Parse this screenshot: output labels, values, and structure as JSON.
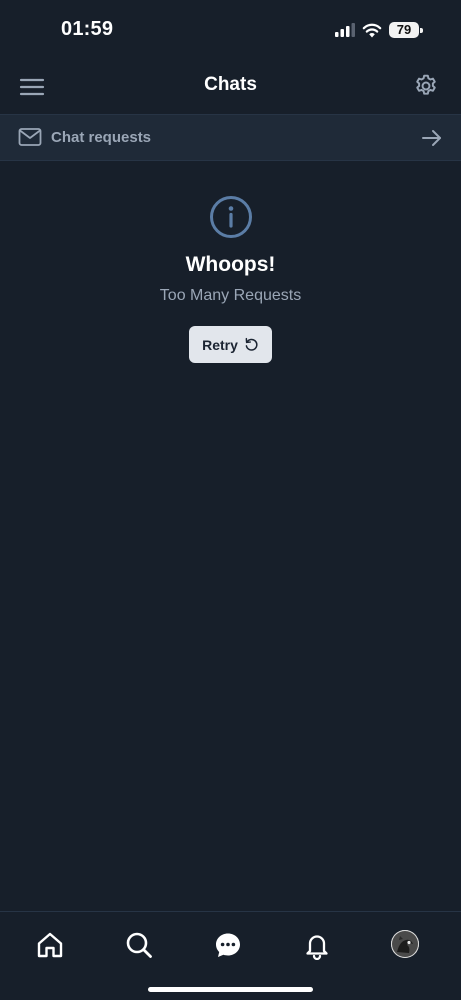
{
  "status_bar": {
    "time": "01:59",
    "battery": "79"
  },
  "header": {
    "title": "Chats",
    "menu_icon": "hamburger-menu-icon",
    "settings_icon": "gear-icon"
  },
  "chat_requests": {
    "label": "Chat requests",
    "icon": "mail-icon",
    "arrow_icon": "arrow-right-icon"
  },
  "error": {
    "icon": "info-icon",
    "title": "Whoops!",
    "message": "Too Many Requests",
    "retry_label": "Retry",
    "retry_icon": "refresh-icon"
  },
  "bottom_nav": {
    "items": [
      {
        "icon": "home-icon"
      },
      {
        "icon": "search-icon"
      },
      {
        "icon": "chat-bubble-icon",
        "active": true
      },
      {
        "icon": "bell-icon"
      },
      {
        "icon": "profile-avatar"
      }
    ]
  },
  "colors": {
    "background": "#171f2a",
    "banner": "#1f2a38",
    "muted_text": "#9aa6b6",
    "info_icon": "#5b7da6",
    "button_bg": "#e2e6ec"
  }
}
